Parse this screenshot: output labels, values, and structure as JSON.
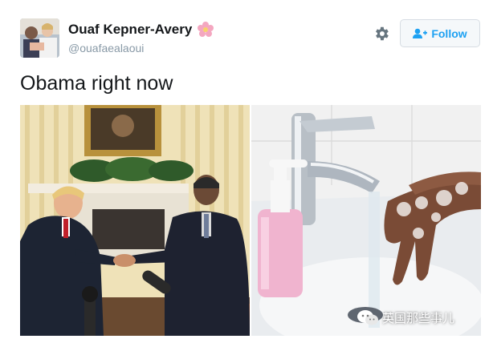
{
  "user": {
    "display_name": "Ouaf Kepner-Avery",
    "handle": "@ouafaealaoui",
    "name_emoji": "flower-emoji"
  },
  "header": {
    "settings_icon": "gear-icon",
    "follow_label": "Follow",
    "follow_icon": "add-user-icon"
  },
  "tweet": {
    "text": "Obama right now"
  },
  "media": {
    "watermark_text": "英国那些事儿",
    "watermark_icon": "wechat-icon"
  },
  "colors": {
    "accent": "#1da1f2",
    "text": "#14171a",
    "muted": "#8899a6"
  }
}
